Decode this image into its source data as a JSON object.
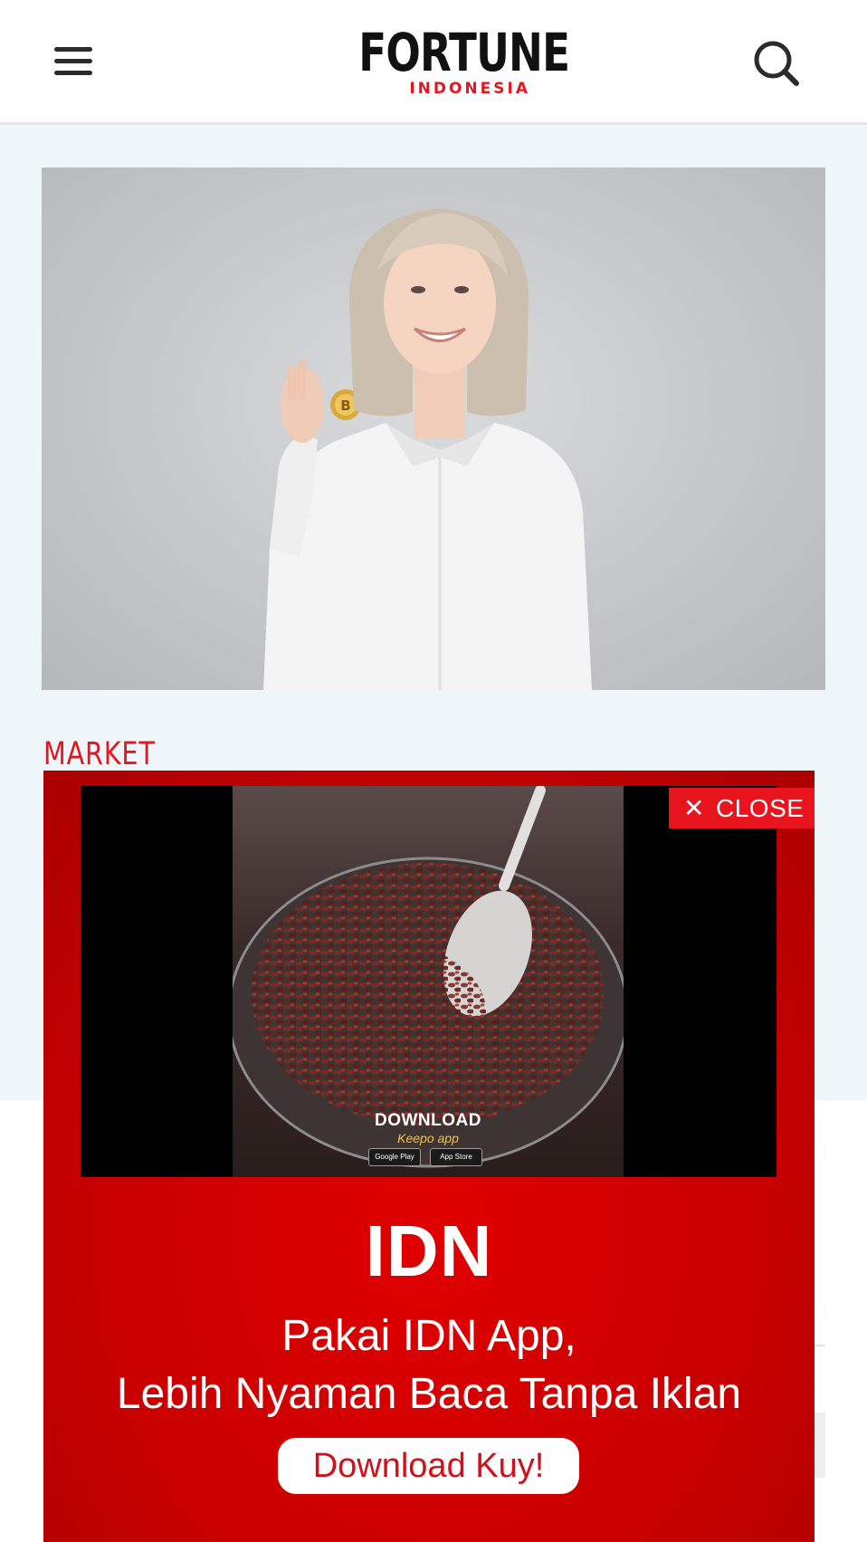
{
  "header": {
    "logo_main": "FORTUNE",
    "logo_sub": "INDONESIA",
    "menu_icon": "hamburger-menu-icon",
    "search_icon": "search-icon"
  },
  "article": {
    "category": "MARKET",
    "hero_image": "woman in white shirt holding a bitcoin coin"
  },
  "ad": {
    "close_label": "CLOSE",
    "close_icon": "close-icon",
    "video": {
      "download_text": "DOWNLOAD",
      "app_text": "Keepo app",
      "store_badges": [
        "Google Play",
        "App Store"
      ]
    },
    "brand": "IDN",
    "line1": "Pakai IDN App,",
    "line2": "Lebih Nyaman Baca Tanpa Iklan",
    "cta_label": "Download Kuy!"
  },
  "colors": {
    "accent_red": "#e8141e",
    "ad_red": "#d40000",
    "article_bg": "#eef6f9"
  }
}
